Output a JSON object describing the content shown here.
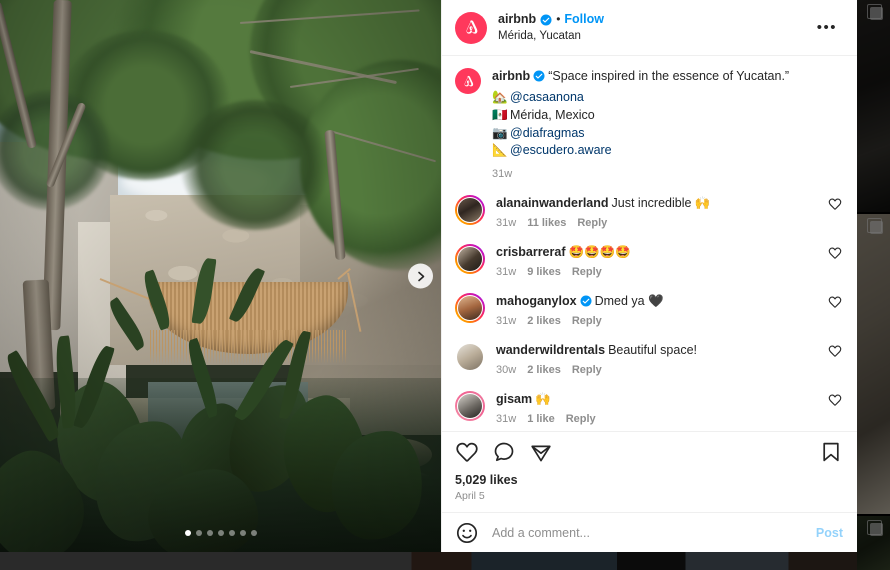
{
  "post": {
    "author": "airbnb",
    "verified_badge": "verified-badge-icon",
    "follow_label": "Follow",
    "separator": "•",
    "location": "Mérida, Yucatan",
    "more_options": "•••",
    "caption": {
      "author": "airbnb",
      "text": "“Space inspired in the essence of Yucatan.”",
      "lines": [
        {
          "icon": "🏡",
          "text": "@casaanona",
          "is_mention": true
        },
        {
          "icon": "🇲🇽",
          "text": "Mérida, Mexico",
          "is_mention": false
        },
        {
          "icon": "📷",
          "text": "@diafragmas",
          "is_mention": true
        },
        {
          "icon": "📐",
          "text": "@escudero.aware",
          "is_mention": true
        }
      ],
      "timestamp": "31w"
    },
    "likes_count": "5,029 likes",
    "date": "April 5"
  },
  "carousel": {
    "total_dots": 7,
    "active_index": 0,
    "next_icon": "chevron-right-icon"
  },
  "comments": [
    {
      "username": "alanainwanderland",
      "verified": false,
      "text": "Just incredible 🙌",
      "timestamp": "31w",
      "likes": "11 likes",
      "reply": "Reply",
      "ring": "gradient"
    },
    {
      "username": "crisbarreraf",
      "verified": false,
      "text": "🤩🤩🤩🤩",
      "timestamp": "31w",
      "likes": "9 likes",
      "reply": "Reply",
      "ring": "gradient"
    },
    {
      "username": "mahoganylox",
      "verified": true,
      "text": "Dmed ya 🖤",
      "timestamp": "31w",
      "likes": "2 likes",
      "reply": "Reply",
      "ring": "gradient"
    },
    {
      "username": "wanderwildrentals",
      "verified": false,
      "text": "Beautiful space!",
      "timestamp": "30w",
      "likes": "2 likes",
      "reply": "Reply",
      "ring": "none"
    },
    {
      "username": "gisam",
      "verified": false,
      "text": "🙌",
      "timestamp": "31w",
      "likes": "1 like",
      "reply": "Reply",
      "ring": "pink"
    }
  ],
  "actions": {
    "like": "heart-icon",
    "comment": "comment-icon",
    "share": "share-icon",
    "save": "bookmark-icon"
  },
  "add_comment": {
    "emoji_icon": "emoji-smiley-icon",
    "placeholder": "Add a comment...",
    "post_label": "Post",
    "value": ""
  },
  "colors": {
    "brand_airbnb": "#FF385C",
    "link_blue": "#0095F6",
    "mention_blue": "#00376B",
    "text_primary": "#262626",
    "text_secondary": "#8e8e8e"
  }
}
